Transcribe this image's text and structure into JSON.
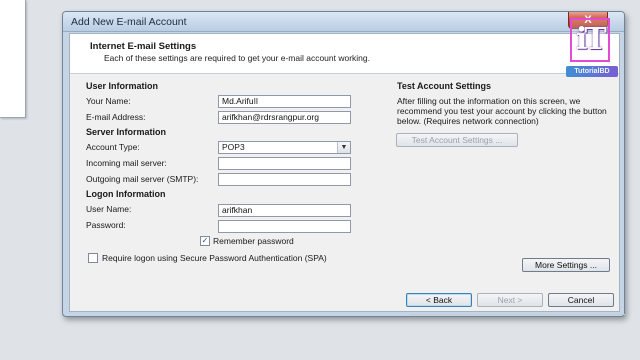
{
  "window": {
    "title": "Add New E-mail Account",
    "close_glyph": "X"
  },
  "header": {
    "title": "Internet E-mail Settings",
    "subtitle": "Each of these settings are required to get your e-mail account working."
  },
  "user_info": {
    "section_title": "User Information",
    "name_label": "Your Name:",
    "name_value": "Md.Arifu",
    "name_cursor": "I",
    "name_tail": "l",
    "email_label": "E-mail Address:",
    "email_value": "arifkhan@rdrsrangpur.org"
  },
  "server_info": {
    "section_title": "Server Information",
    "account_type_label": "Account Type:",
    "account_type_value": "POP3",
    "incoming_label": "Incoming mail server:",
    "incoming_value": "",
    "outgoing_label": "Outgoing mail server (SMTP):",
    "outgoing_value": ""
  },
  "logon_info": {
    "section_title": "Logon Information",
    "username_label": "User Name:",
    "username_value": "arifkhan",
    "password_label": "Password:",
    "password_value": "",
    "remember_label": "Remember password",
    "remember_checked": true,
    "spa_label": "Require logon using Secure Password Authentication (SPA)",
    "spa_checked": false
  },
  "test_settings": {
    "title": "Test Account Settings",
    "description": "After filling out the information on this screen, we recommend you test your account by clicking the button below. (Requires network connection)",
    "button_label": "Test Account Settings ..."
  },
  "buttons": {
    "more_settings": "More Settings ...",
    "back": "< Back",
    "next": "Next >",
    "cancel": "Cancel"
  },
  "logo": {
    "letters": "iT",
    "caption": "TutorialBD"
  }
}
